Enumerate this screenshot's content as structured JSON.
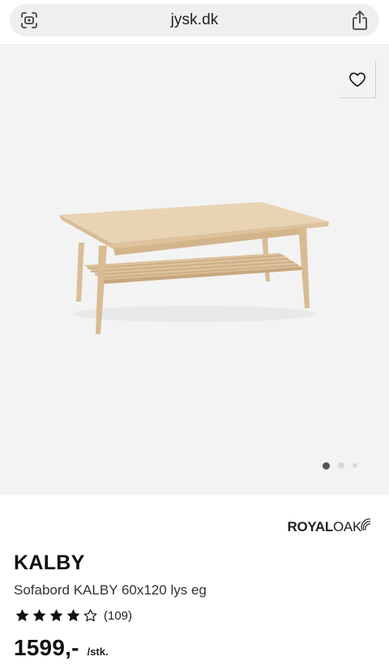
{
  "browser": {
    "url": "jysk.dk",
    "left_icon": "page-menu-icon",
    "right_icon": "share-icon"
  },
  "gallery": {
    "wishlist_icon": "heart-icon",
    "image_count": 3,
    "active_index": 0
  },
  "product": {
    "brand": {
      "bold": "ROYAL",
      "light": "OAK"
    },
    "name": "KALBY",
    "description": "Sofabord KALBY 60x120 lys eg",
    "rating": {
      "stars": 4,
      "max": 5,
      "count_text": "(109)"
    },
    "price": "1599,-",
    "unit": "/stk."
  },
  "colors": {
    "gallery_bg": "#f3f3f3",
    "wood": "#e3cba9",
    "text": "#111111"
  }
}
